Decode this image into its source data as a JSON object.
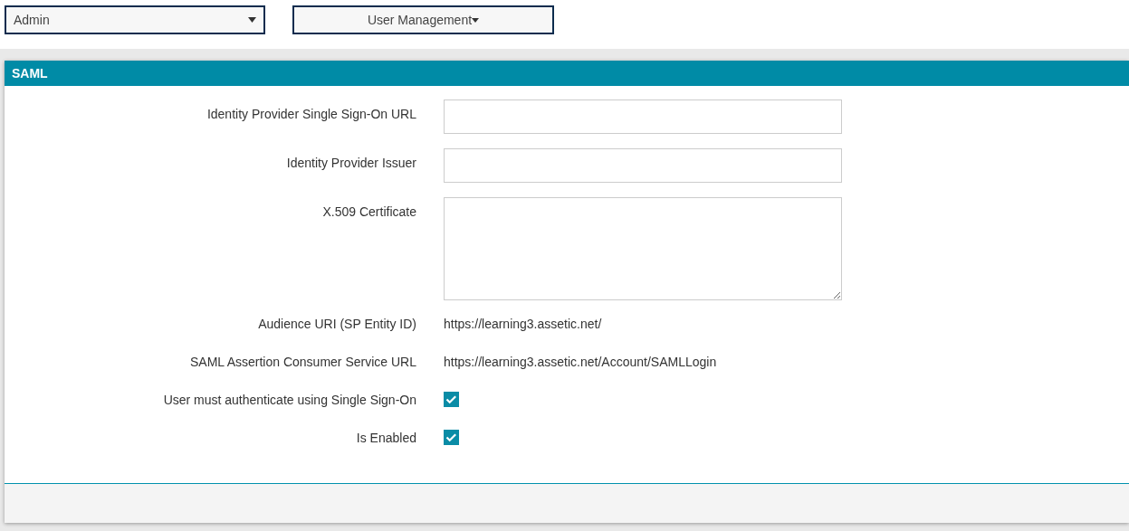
{
  "toolbar": {
    "role_select": {
      "value": "Admin"
    },
    "menu_button": {
      "label": "User Management"
    }
  },
  "panel": {
    "title": "SAML",
    "rows": [
      {
        "kind": "input",
        "label": "Identity Provider Single Sign-On URL"
      },
      {
        "kind": "input",
        "label": "Identity Provider Issuer"
      },
      {
        "kind": "textarea",
        "label": "X.509 Certificate"
      },
      {
        "kind": "text",
        "label": "Audience URI (SP Entity ID)",
        "value": "https://learning3.assetic.net/"
      },
      {
        "kind": "text",
        "label": "SAML Assertion Consumer Service URL",
        "value": "https://learning3.assetic.net/Account/SAMLLogin"
      },
      {
        "kind": "checkbox",
        "label": "User must authenticate using Single Sign-On",
        "checked": true
      },
      {
        "kind": "checkbox",
        "label": "Is Enabled",
        "checked": true
      }
    ]
  }
}
